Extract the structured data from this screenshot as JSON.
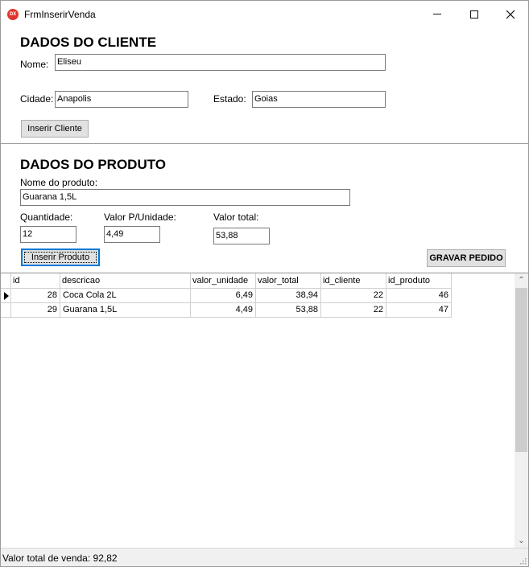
{
  "window": {
    "title": "FrmInserirVenda",
    "app_icon_text": "DX"
  },
  "cliente": {
    "section_title": "DADOS DO CLIENTE",
    "nome_label": "Nome:",
    "nome_value": "Eliseu",
    "cidade_label": "Cidade:",
    "cidade_value": "Anapolis",
    "estado_label": "Estado:",
    "estado_value": "Goias",
    "inserir_button": "Inserir Cliente"
  },
  "produto": {
    "section_title": "DADOS DO PRODUTO",
    "nome_label": "Nome do produto:",
    "nome_value": "Guarana 1,5L",
    "quantidade_label": "Quantidade:",
    "quantidade_value": "12",
    "valor_unidade_label": "Valor P/Unidade:",
    "valor_unidade_value": "4,49",
    "valor_total_label": "Valor total:",
    "valor_total_value": "53,88",
    "inserir_button": "Inserir Produto",
    "gravar_button": "GRAVAR PEDIDO"
  },
  "grid": {
    "columns": [
      "id",
      "descricao",
      "valor_unidade",
      "valor_total",
      "id_cliente",
      "id_produto"
    ],
    "rows": [
      {
        "id": "28",
        "descricao": "Coca Cola 2L",
        "valor_unidade": "6,49",
        "valor_total": "38,94",
        "id_cliente": "22",
        "id_produto": "46"
      },
      {
        "id": "29",
        "descricao": "Guarana 1,5L",
        "valor_unidade": "4,49",
        "valor_total": "53,88",
        "id_cliente": "22",
        "id_produto": "47"
      }
    ],
    "current_row": 0
  },
  "status": {
    "text": "Valor total de venda: 92,82"
  }
}
